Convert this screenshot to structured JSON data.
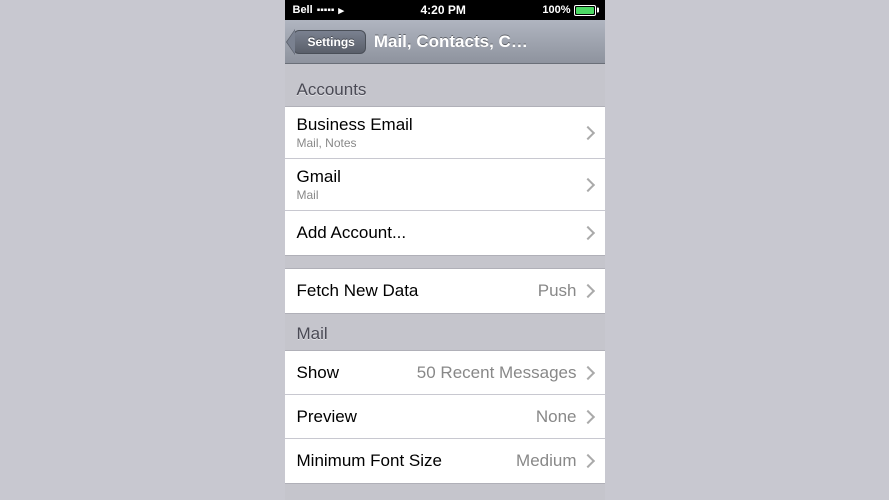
{
  "statusBar": {
    "carrier": "Bell",
    "time": "4:20 PM",
    "battery": "100%"
  },
  "navBar": {
    "backLabel": "Settings",
    "title": "Mail, Contacts, Calen..."
  },
  "accounts": {
    "sectionHeader": "Accounts",
    "items": [
      {
        "title": "Business Email",
        "subtitle": "Mail, Notes"
      },
      {
        "title": "Gmail",
        "subtitle": "Mail"
      },
      {
        "title": "Add Account...",
        "subtitle": ""
      }
    ]
  },
  "fetchNewData": {
    "label": "Fetch New Data",
    "value": "Push"
  },
  "mail": {
    "sectionHeader": "Mail",
    "items": [
      {
        "label": "Show",
        "value": "50 Recent Messages"
      },
      {
        "label": "Preview",
        "value": "None"
      },
      {
        "label": "Minimum Font Size",
        "value": "Medium"
      }
    ]
  }
}
